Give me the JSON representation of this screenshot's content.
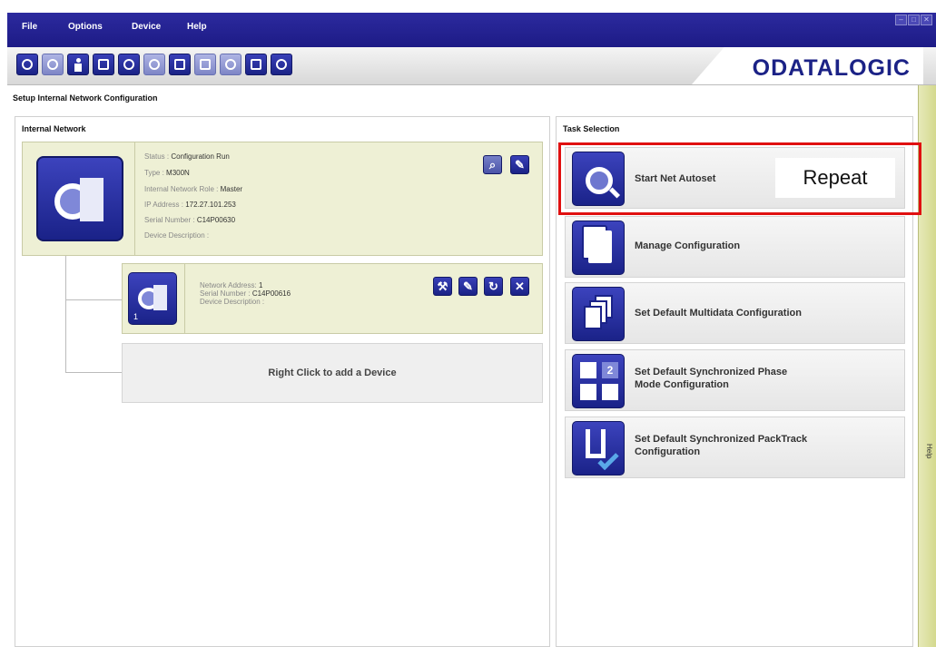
{
  "menu": [
    "File",
    "Options",
    "Device",
    "Help"
  ],
  "window_controls": [
    "–",
    "□",
    "✕"
  ],
  "toolbar": {
    "icons": [
      "home-icon",
      "device-scan-icon",
      "user-icon",
      "window-icon",
      "search-device-icon",
      "device-config-icon",
      "image-icon",
      "monitor-icon",
      "network-icon",
      "list-icon",
      "crosshair-icon"
    ]
  },
  "brand": {
    "logo": "ODATALOGIC",
    "accent": "#1b2286"
  },
  "page_title": "Setup Internal Network Configuration",
  "help_tab": "Help",
  "internal_network": {
    "heading": "Internal Network",
    "master": {
      "status_label": "Status :",
      "status": "Configuration Run",
      "type_label": "Type :",
      "type": "M300N",
      "role_label": "Internal Network Role :",
      "role": "Master",
      "ip_label": "IP Address :",
      "ip": "172.27.101.253",
      "serial_label": "Serial Number :",
      "serial": "C14P00630",
      "desc_label": "Device Description :",
      "desc": ""
    },
    "slave": {
      "index": "1",
      "address_label": "Network Address:",
      "address": "1",
      "serial_label": "Serial Number :",
      "serial": "C14P00616",
      "desc_label": "Device Description :",
      "desc": ""
    },
    "add_device": "Right Click to add a Device"
  },
  "task_selection": {
    "heading": "Task Selection",
    "tasks": [
      {
        "label_1": "Start Net Autoset",
        "label_2": ""
      },
      {
        "label_1": "Manage Configuration",
        "label_2": ""
      },
      {
        "label_1": "Set Default Multidata Configuration",
        "label_2": ""
      },
      {
        "label_1": "Set Default Synchronized Phase",
        "label_2": "Mode Configuration"
      },
      {
        "label_1": "Set Default Synchronized PackTrack",
        "label_2": "Configuration"
      }
    ]
  },
  "annotation": {
    "text": "Repeat",
    "color": "#e01010"
  }
}
